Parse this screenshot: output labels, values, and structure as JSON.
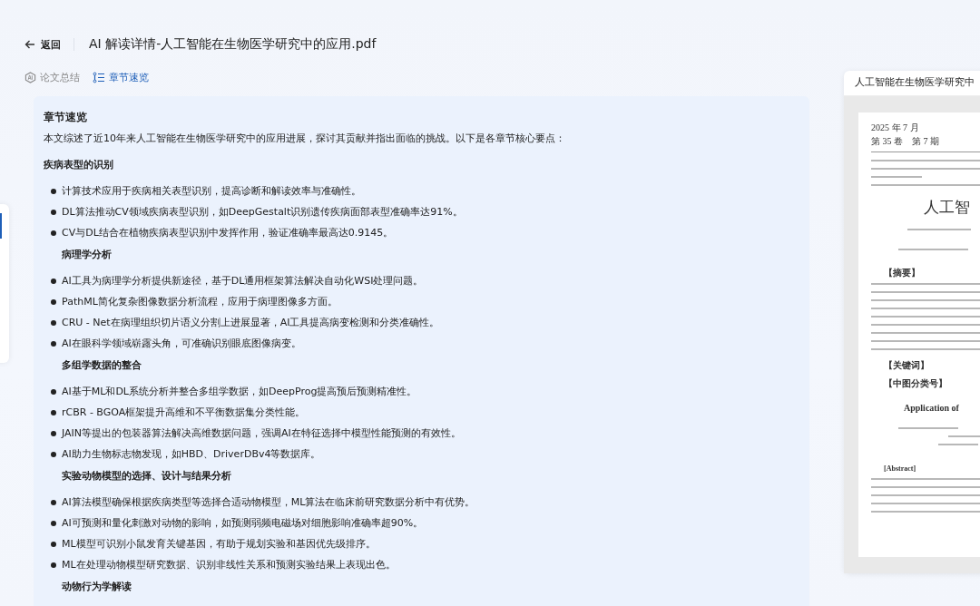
{
  "header": {
    "back_label": "返回",
    "title": "AI 解读详情-人工智能在生物医学研究中的应用.pdf"
  },
  "tabs": [
    {
      "label": "论文总结",
      "selected": false
    },
    {
      "label": "章节速览",
      "selected": true
    }
  ],
  "overview": {
    "heading": "章节速览",
    "intro": "本文综述了近10年来人工智能在生物医学研究中的应用进展，探讨其贡献并指出面临的挑战。以下是各章节核心要点：",
    "sections": [
      {
        "kind": "top",
        "title": "疾病表型的识别",
        "points": [
          "计算技术应用于疾病相关表型识别，提高诊断和解读效率与准确性。",
          "DL算法推动CV领域疾病表型识别，如DeepGestalt识别遗传疾病面部表型准确率达91%。",
          "CV与DL结合在植物疾病表型识别中发挥作用，验证准确率最高达0.9145。"
        ]
      },
      {
        "kind": "sub",
        "title": "病理学分析",
        "points": [
          "AI工具为病理学分析提供新途径，基于DL通用框架算法解决自动化WSI处理问题。",
          "PathML简化复杂图像数据分析流程，应用于病理图像多方面。",
          "CRU - Net在病理组织切片语义分割上进展显著，AI工具提高病变检测和分类准确性。",
          "AI在眼科学领域崭露头角，可准确识别眼底图像病变。"
        ]
      },
      {
        "kind": "sub",
        "title": "多组学数据的整合",
        "points": [
          "AI基于ML和DL系统分析并整合多组学数据，如DeepProg提高预后预测精准性。",
          "rCBR - BGOA框架提升高维和不平衡数据集分类性能。",
          "JAIN等提出的包装器算法解决高维数据问题，强调AI在特征选择中模型性能预测的有效性。",
          "AI助力生物标志物发现，如HBD、DriverDBv4等数据库。"
        ]
      },
      {
        "kind": "sub",
        "title": "实验动物模型的选择、设计与结果分析",
        "points": [
          "AI算法模型确保根据疾病类型等选择合适动物模型，ML算法在临床前研究数据分析中有优势。",
          "AI可预测和量化刺激对动物的影响，如预测弱频电磁场对细胞影响准确率超90%。",
          "ML模型可识别小鼠发育关键基因，有助于规划实验和基因优先级排序。",
          "ML在处理动物模型研究数据、识别非线性关系和预测实验结果上表现出色。"
        ]
      },
      {
        "kind": "sub",
        "title": "动物行为学解读"
      }
    ]
  },
  "preview": {
    "title": "人工智能在生物医学研究中",
    "page": {
      "date": "2025 年 7 月",
      "volume": "第 35 卷　第 7 期",
      "doc_title": "人工智",
      "abstract_label": "【摘要】",
      "keywords_label": "【关键词】",
      "class_label": "【中图分类号】",
      "en_title": "Application of",
      "en_abstract_label": "[Abstract]"
    }
  }
}
